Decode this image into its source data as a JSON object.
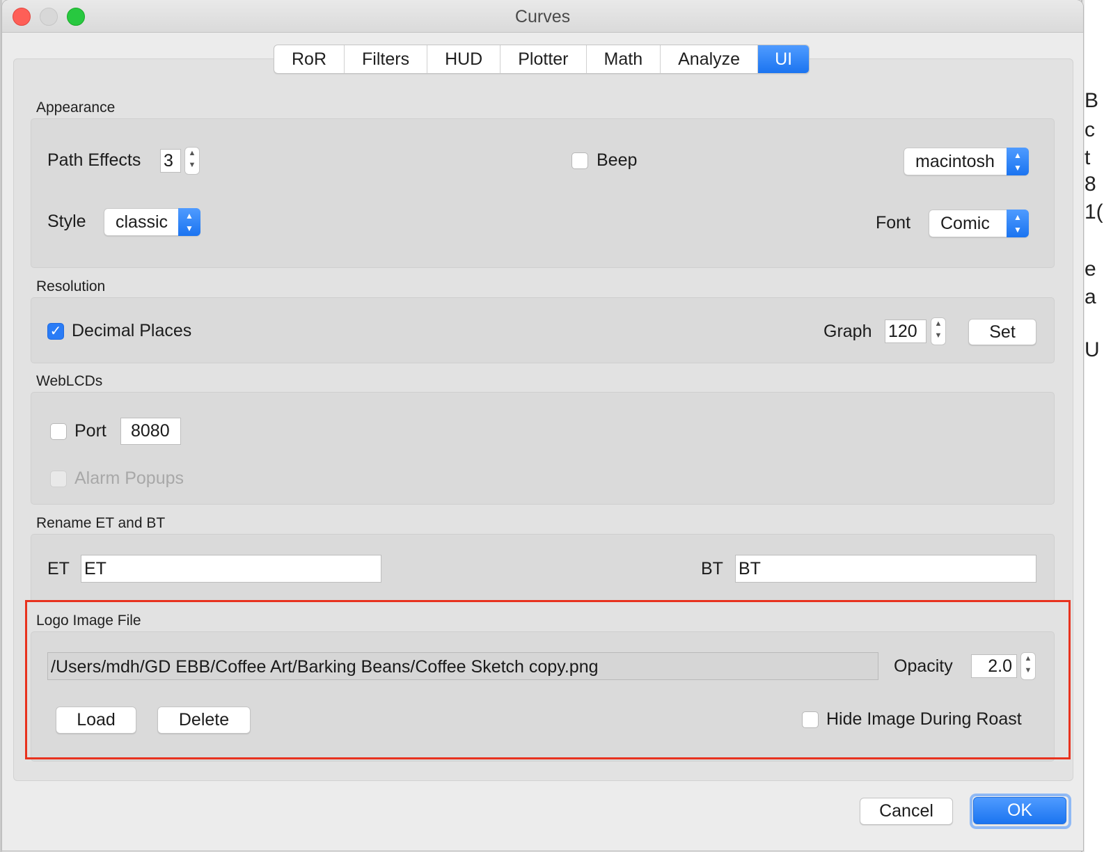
{
  "window": {
    "title": "Curves"
  },
  "tabs": [
    {
      "label": "RoR",
      "active": false
    },
    {
      "label": "Filters",
      "active": false
    },
    {
      "label": "HUD",
      "active": false
    },
    {
      "label": "Plotter",
      "active": false
    },
    {
      "label": "Math",
      "active": false
    },
    {
      "label": "Analyze",
      "active": false
    },
    {
      "label": "UI",
      "active": true
    }
  ],
  "appearance": {
    "title": "Appearance",
    "path_effects_label": "Path Effects",
    "path_effects_value": "3",
    "beep_label": "Beep",
    "beep_checked": false,
    "platform_value": "macintosh",
    "style_label": "Style",
    "style_value": "classic",
    "font_label": "Font",
    "font_value": "Comic"
  },
  "resolution": {
    "title": "Resolution",
    "decimal_places_label": "Decimal Places",
    "decimal_places_checked": true,
    "graph_label": "Graph",
    "graph_value": "120",
    "set_label": "Set"
  },
  "weblcds": {
    "title": "WebLCDs",
    "port_label": "Port",
    "port_checked": false,
    "port_value": "8080",
    "alarm_popups_label": "Alarm Popups",
    "alarm_popups_enabled": false
  },
  "rename": {
    "title": "Rename ET and BT",
    "et_label": "ET",
    "et_value": "ET",
    "bt_label": "BT",
    "bt_value": "BT"
  },
  "logo": {
    "title": "Logo Image File",
    "path_value": "/Users/mdh/GD EBB/Coffee Art/Barking Beans/Coffee Sketch copy.png",
    "opacity_label": "Opacity",
    "opacity_value": "2.0",
    "load_label": "Load",
    "delete_label": "Delete",
    "hide_label": "Hide Image During Roast",
    "hide_checked": false
  },
  "footer": {
    "cancel_label": "Cancel",
    "ok_label": "OK"
  },
  "colors": {
    "accent": "#1b74f0",
    "highlight": "#e8321e"
  }
}
